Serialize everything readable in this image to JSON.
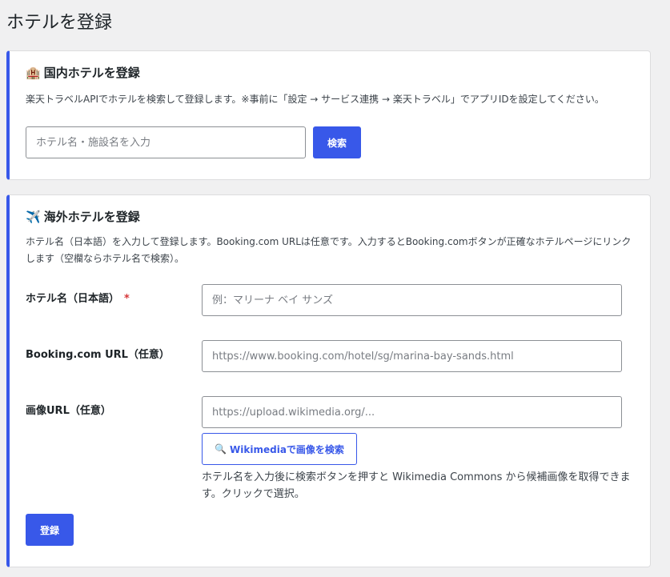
{
  "page": {
    "title": "ホテルを登録"
  },
  "domestic": {
    "icon": "🏨",
    "icon_name": "hotel-icon",
    "title": "国内ホテルを登録",
    "description": "楽天トラベルAPIでホテルを検索して登録します。※事前に「設定 → サービス連携 → 楽天トラベル」でアプリIDを設定してください。",
    "search_placeholder": "ホテル名・施設名を入力",
    "search_value": "",
    "search_button": "検索"
  },
  "overseas": {
    "icon": "✈️",
    "icon_name": "airplane-icon",
    "title": "海外ホテルを登録",
    "description": "ホテル名（日本語）を入力して登録します。Booking.com URLは任意です。入力するとBooking.comボタンが正確なホテルページにリンクします（空欄ならホテル名で検索）。",
    "name_label": "ホテル名（日本語）",
    "required_mark": "*",
    "name_placeholder": "例：マリーナ ベイ サンズ",
    "booking_label": "Booking.com URL（任意）",
    "booking_placeholder": "https://www.booking.com/hotel/sg/marina-bay-sands.html",
    "image_label": "画像URL（任意）",
    "image_placeholder": "https://upload.wikimedia.org/...",
    "wiki_icon": "🔍",
    "wiki_button": "Wikimediaで画像を検索",
    "wiki_help": "ホテル名を入力後に検索ボタンを押すと Wikimedia Commons から候補画像を取得できます。クリックで選択。",
    "submit_button": "登録"
  },
  "colors": {
    "accent": "#3858e9",
    "required": "#d63638",
    "background": "#f0f0f1"
  }
}
